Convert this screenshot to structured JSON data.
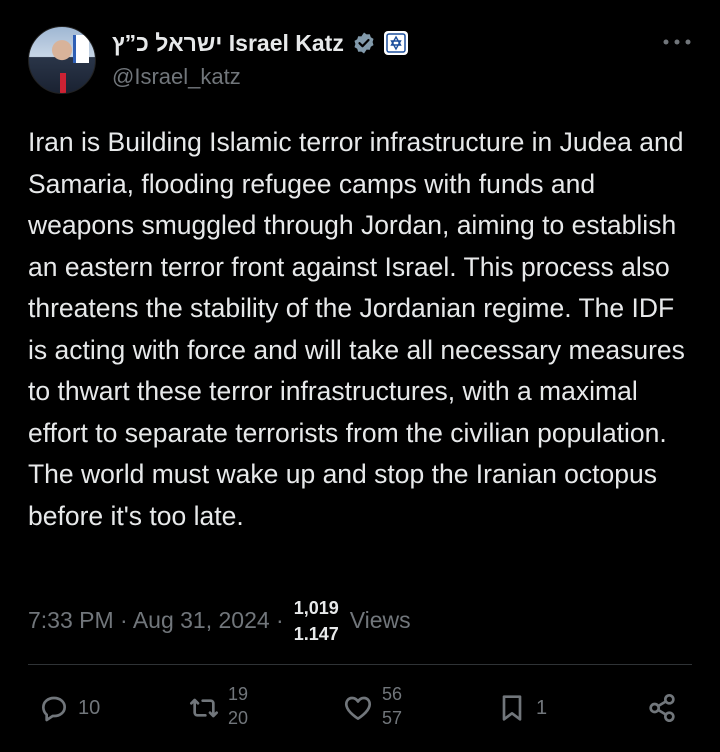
{
  "author": {
    "display_name": "ישראל כ”ץ Israel Katz",
    "handle": "@Israel_katz"
  },
  "tweet": {
    "text": "Iran is Building Islamic terror infrastructure in Judea and Samaria, flooding refugee camps with funds and weapons smuggled through Jordan, aiming to establish an eastern terror front against Israel. This process also threatens the stability of the Jordanian regime. The IDF is acting with force and will take all necessary measures to thwart these terror infrastructures, with a maximal effort to separate terrorists from the civilian population. The world must wake up and stop the Iranian octopus before it's too late."
  },
  "meta": {
    "timestamp": "7:33 PM · Aug 31, 2024 ·",
    "views_count_top": "1,019",
    "views_count_bottom": "1,147",
    "views_label": "Views"
  },
  "actions": {
    "replies": "10",
    "reposts_top": "19",
    "reposts_bottom": "20",
    "likes_top": "56",
    "likes_bottom": "57",
    "bookmarks": "1"
  },
  "icons": {
    "more": "more-options-icon",
    "verified": "verified-badge-icon",
    "org": "government-org-badge-icon",
    "reply": "reply-icon",
    "repost": "repost-icon",
    "like": "heart-icon",
    "bookmark": "bookmark-icon",
    "share": "share-icon"
  },
  "colors": {
    "background": "#000000",
    "text": "#e7e9ea",
    "muted": "#71767b",
    "divider": "#2f3336",
    "verified": "#829aab"
  }
}
